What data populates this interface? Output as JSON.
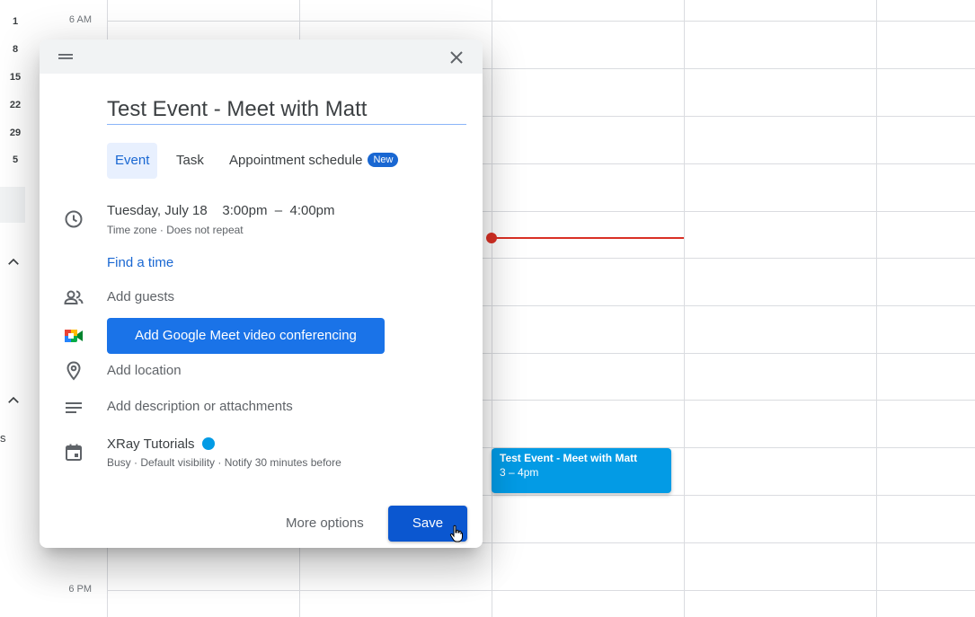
{
  "mini_calendar": {
    "dates": [
      "1",
      "8",
      "15",
      "22",
      "29",
      "5"
    ]
  },
  "left_edge_text": "s",
  "time_labels": {
    "top": "6 AM",
    "bottom": "6 PM"
  },
  "event_block": {
    "title": "Test Event - Meet with Matt",
    "time": "3 – 4pm",
    "color": "#039be5"
  },
  "dialog": {
    "title_value": "Test Event - Meet with Matt",
    "tabs": [
      {
        "label": "Event",
        "active": true
      },
      {
        "label": "Task",
        "active": false
      },
      {
        "label": "Appointment schedule",
        "active": false,
        "badge": "New"
      }
    ],
    "datetime": {
      "date": "Tuesday, July 18",
      "start": "3:00pm",
      "separator": "–",
      "end": "4:00pm"
    },
    "timezone_line": "Time zone · Does not repeat",
    "find_time": "Find a time",
    "add_guests": "Add guests",
    "meet_button": "Add Google Meet video conferencing",
    "add_location": "Add location",
    "add_description": "Add description or attachments",
    "calendar": {
      "name": "XRay Tutorials",
      "color": "#039be5",
      "details": "Busy · Default visibility · Notify 30 minutes before"
    },
    "more_options": "More options",
    "save": "Save"
  },
  "colors": {
    "accent": "#1a73e8",
    "save": "#0b57d0",
    "now_line": "#d93025"
  }
}
